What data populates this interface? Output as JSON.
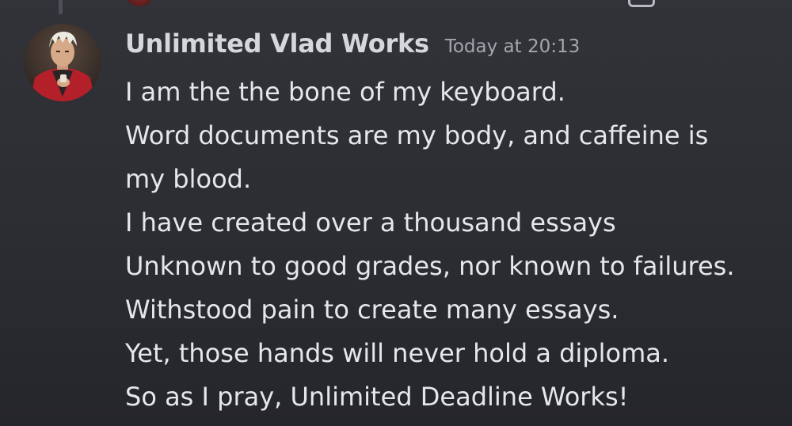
{
  "message": {
    "username": "Unlimited Vlad Works",
    "timestamp": "Today at 20:13",
    "lines": [
      "I am the the bone of my keyboard.",
      "Word documents are my body, and caffeine is",
      "my blood.",
      "I have created over a thousand essays",
      "Unknown to good grades, nor known to failures.",
      "Withstood pain to create many essays.",
      "Yet, those hands will never hold a diploma.",
      "So as I pray, Unlimited Deadline Works!"
    ]
  },
  "colors": {
    "background": "#313338",
    "username": "#d6d7dc",
    "timestamp": "#a3a6ad",
    "text": "#e6e7ea"
  },
  "icons": {
    "avatar": "anime-character-avatar",
    "previous_icon": "image-attachment-icon"
  }
}
